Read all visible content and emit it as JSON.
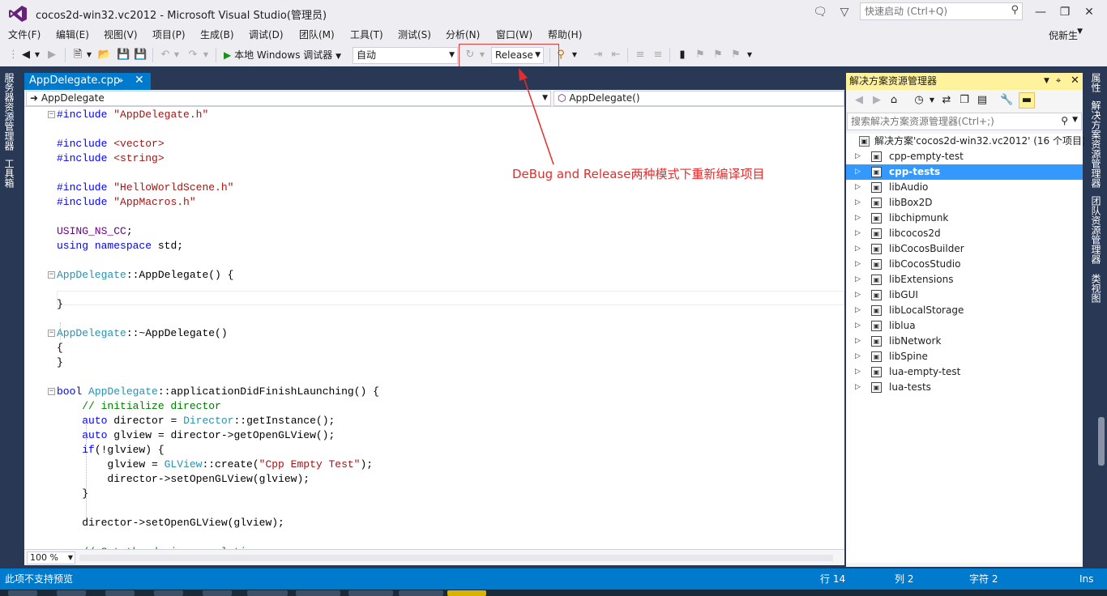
{
  "window": {
    "title": "cocos2d-win32.vc2012 - Microsoft Visual Studio(管理员)",
    "quick_launch_placeholder": "快速启动 (Ctrl+Q)"
  },
  "menu": {
    "items": [
      "文件(F)",
      "编辑(E)",
      "视图(V)",
      "项目(P)",
      "生成(B)",
      "调试(D)",
      "团队(M)",
      "工具(T)",
      "测试(S)",
      "分析(N)",
      "窗口(W)",
      "帮助(H)"
    ],
    "user": "倪新生"
  },
  "toolbar": {
    "run_label": "本地 Windows 调试器",
    "solution_config": "自动",
    "build_config": "Release"
  },
  "left_rail": {
    "tabs": [
      "服务器资源管理器",
      "工具箱"
    ]
  },
  "editor": {
    "tab_title": "AppDelegate.cpp",
    "nav_left": "AppDelegate",
    "nav_right": "AppDelegate()",
    "zoom": "100 %"
  },
  "annotation": {
    "text": "DeBug and Release两种模式下重新编译项目"
  },
  "solution_explorer": {
    "title": "解决方案资源管理器",
    "search_placeholder": "搜索解决方案资源管理器(Ctrl+;)",
    "root": "解决方案'cocos2d-win32.vc2012' (16 个项目)",
    "projects": [
      "cpp-empty-test",
      "cpp-tests",
      "libAudio",
      "libBox2D",
      "libchipmunk",
      "libcocos2d",
      "libCocosBuilder",
      "libCocosStudio",
      "libExtensions",
      "libGUI",
      "libLocalStorage",
      "liblua",
      "libNetwork",
      "libSpine",
      "lua-empty-test",
      "lua-tests"
    ],
    "selected_index": 1
  },
  "right_rail": {
    "tabs": [
      "属性",
      "解决方案资源管理器",
      "团队资源管理器",
      "类视图"
    ]
  },
  "status": {
    "message": "此项不支持预览",
    "line": "行 14",
    "col": "列 2",
    "char": "字符 2",
    "mode": "Ins"
  },
  "colors": {
    "accent": "#007acc",
    "frame": "#293955",
    "annotation": "#e62c2c",
    "selection": "#3399ff",
    "panel_header": "#fff29d"
  }
}
